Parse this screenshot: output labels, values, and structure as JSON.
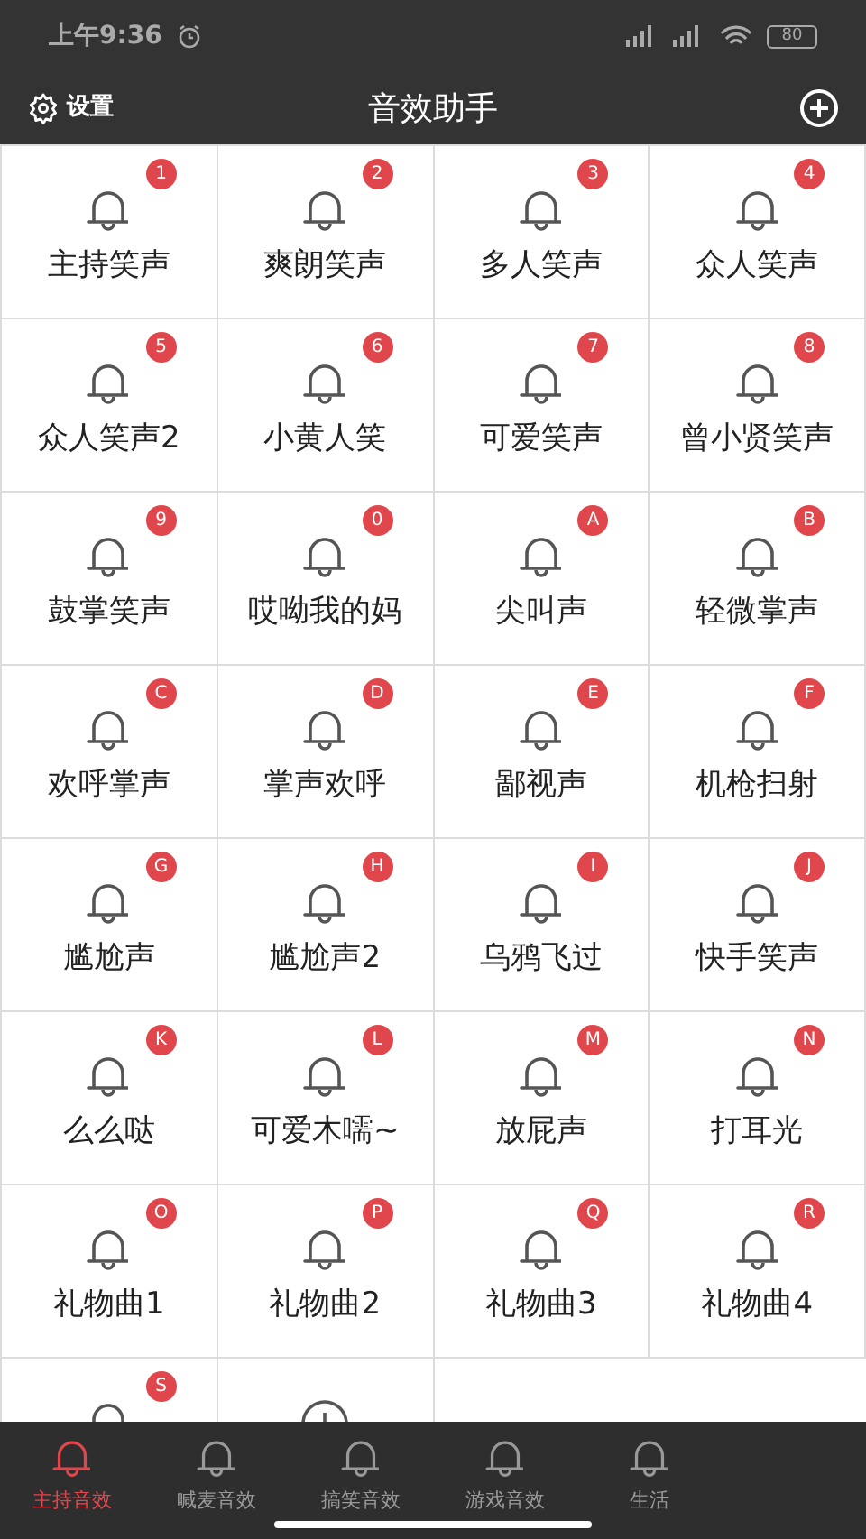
{
  "status_bar": {
    "time": "上午9:36",
    "battery": "80"
  },
  "header": {
    "settings_label": "设置",
    "title": "音效助手"
  },
  "sounds": [
    {
      "kind": "sound",
      "badge": "1",
      "label": "主持笑声"
    },
    {
      "kind": "sound",
      "badge": "2",
      "label": "爽朗笑声"
    },
    {
      "kind": "sound",
      "badge": "3",
      "label": "多人笑声"
    },
    {
      "kind": "sound",
      "badge": "4",
      "label": "众人笑声"
    },
    {
      "kind": "sound",
      "badge": "5",
      "label": "众人笑声2"
    },
    {
      "kind": "sound",
      "badge": "6",
      "label": "小黄人笑"
    },
    {
      "kind": "sound",
      "badge": "7",
      "label": "可爱笑声"
    },
    {
      "kind": "sound",
      "badge": "8",
      "label": "曾小贤笑声"
    },
    {
      "kind": "sound",
      "badge": "9",
      "label": "鼓掌笑声"
    },
    {
      "kind": "sound",
      "badge": "0",
      "label": "哎呦我的妈"
    },
    {
      "kind": "sound",
      "badge": "A",
      "label": "尖叫声"
    },
    {
      "kind": "sound",
      "badge": "B",
      "label": "轻微掌声"
    },
    {
      "kind": "sound",
      "badge": "C",
      "label": "欢呼掌声"
    },
    {
      "kind": "sound",
      "badge": "D",
      "label": "掌声欢呼"
    },
    {
      "kind": "sound",
      "badge": "E",
      "label": "鄙视声"
    },
    {
      "kind": "sound",
      "badge": "F",
      "label": "机枪扫射"
    },
    {
      "kind": "sound",
      "badge": "G",
      "label": "尴尬声"
    },
    {
      "kind": "sound",
      "badge": "H",
      "label": "尴尬声2"
    },
    {
      "kind": "sound",
      "badge": "I",
      "label": "乌鸦飞过"
    },
    {
      "kind": "sound",
      "badge": "J",
      "label": "快手笑声"
    },
    {
      "kind": "sound",
      "badge": "K",
      "label": "么么哒"
    },
    {
      "kind": "sound",
      "badge": "L",
      "label": "可爱木嚅~"
    },
    {
      "kind": "sound",
      "badge": "M",
      "label": "放屁声"
    },
    {
      "kind": "sound",
      "badge": "N",
      "label": "打耳光"
    },
    {
      "kind": "sound",
      "badge": "O",
      "label": "礼物曲1"
    },
    {
      "kind": "sound",
      "badge": "P",
      "label": "礼物曲2"
    },
    {
      "kind": "sound",
      "badge": "Q",
      "label": "礼物曲3"
    },
    {
      "kind": "sound",
      "badge": "R",
      "label": "礼物曲4"
    },
    {
      "kind": "sound",
      "badge": "S"
    },
    {
      "kind": "add"
    }
  ],
  "tabs": [
    {
      "label": "主持音效",
      "selected": true
    },
    {
      "label": "喊麦音效",
      "selected": false
    },
    {
      "label": "搞笑音效",
      "selected": false
    },
    {
      "label": "游戏音效",
      "selected": false
    },
    {
      "label": "生活",
      "selected": false
    }
  ]
}
